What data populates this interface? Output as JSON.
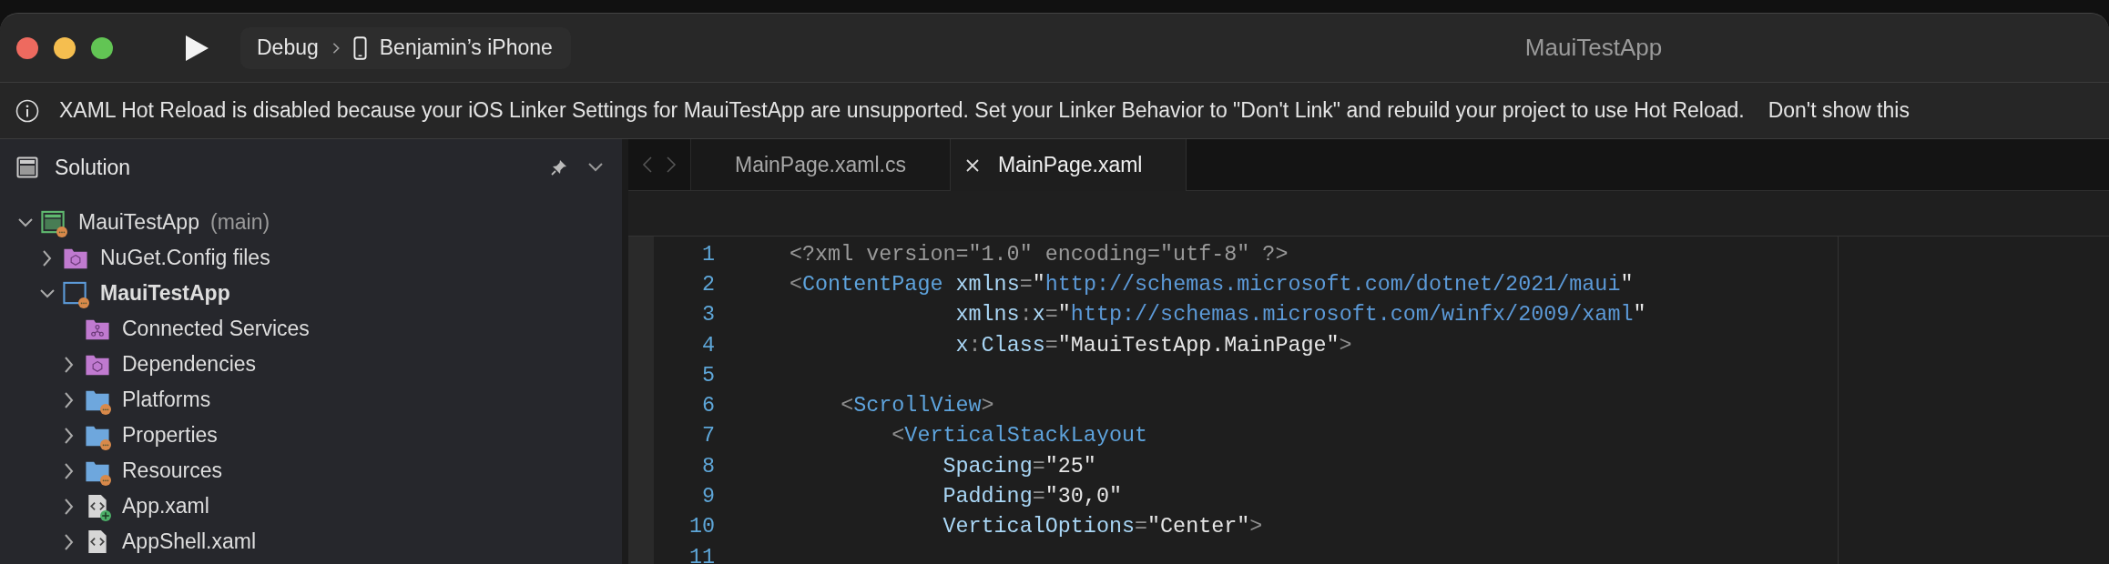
{
  "window": {
    "title": "MauiTestApp",
    "traffic_lights": [
      {
        "color": "#ee6a5f"
      },
      {
        "color": "#f5be4f"
      },
      {
        "color": "#62c554"
      }
    ]
  },
  "toolbar": {
    "configuration": "Debug",
    "device": "Benjamin’s iPhone"
  },
  "info_bar": {
    "message": "XAML Hot Reload is disabled because your iOS Linker Settings for MauiTestApp are unsupported. Set your Linker Behavior to \"Don't Link\" and rebuild your project to use Hot Reload.",
    "action": "Don't show this"
  },
  "sidebar": {
    "title": "Solution",
    "tree": [
      {
        "kind": "solution",
        "name": "MauiTestApp",
        "branch": "(main)",
        "modified": true,
        "expanded": true,
        "children": [
          {
            "kind": "package-folder",
            "name": "NuGet.Config files",
            "expanded": false
          },
          {
            "kind": "project",
            "name": "MauiTestApp",
            "modified": true,
            "expanded": true,
            "children": [
              {
                "kind": "service-folder",
                "name": "Connected Services"
              },
              {
                "kind": "package-folder",
                "name": "Dependencies",
                "expanded": false
              },
              {
                "kind": "folder",
                "name": "Platforms",
                "modified": true,
                "expanded": false
              },
              {
                "kind": "folder",
                "name": "Properties",
                "modified": true,
                "expanded": false
              },
              {
                "kind": "folder",
                "name": "Resources",
                "modified": true,
                "expanded": false
              },
              {
                "kind": "xaml-file",
                "name": "App.xaml",
                "added": true,
                "expanded": false
              },
              {
                "kind": "xaml-file",
                "name": "AppShell.xaml",
                "expanded": false
              }
            ]
          }
        ]
      }
    ]
  },
  "editor": {
    "tabs": [
      {
        "label": "MainPage.xaml.cs",
        "selected": false
      },
      {
        "label": "MainPage.xaml",
        "selected": true
      }
    ],
    "lines": [
      {
        "number": "1",
        "tokens": [
          {
            "kind": "decl",
            "text": "<?xml version=\"1.0\" encoding=\"utf-8\" ?>"
          }
        ]
      },
      {
        "number": "2",
        "tokens": [
          {
            "kind": "punct",
            "text": "<"
          },
          {
            "kind": "tag",
            "text": "ContentPage"
          },
          {
            "kind": "attr",
            "text": " xmlns"
          },
          {
            "kind": "punct",
            "text": "="
          },
          {
            "kind": "value",
            "text": "\""
          },
          {
            "kind": "url",
            "text": "http://schemas.microsoft.com/dotnet/2021/maui"
          },
          {
            "kind": "value",
            "text": "\""
          }
        ]
      },
      {
        "number": "3",
        "tokens": [
          {
            "kind": "attr",
            "text": "             xmlns"
          },
          {
            "kind": "punct",
            "text": ":"
          },
          {
            "kind": "attr",
            "text": "x"
          },
          {
            "kind": "punct",
            "text": "="
          },
          {
            "kind": "value",
            "text": "\""
          },
          {
            "kind": "url",
            "text": "http://schemas.microsoft.com/winfx/2009/xaml"
          },
          {
            "kind": "value",
            "text": "\""
          }
        ]
      },
      {
        "number": "4",
        "tokens": [
          {
            "kind": "attr",
            "text": "             x"
          },
          {
            "kind": "punct",
            "text": ":"
          },
          {
            "kind": "attr",
            "text": "Class"
          },
          {
            "kind": "punct",
            "text": "="
          },
          {
            "kind": "value",
            "text": "\"MauiTestApp.MainPage\""
          },
          {
            "kind": "punct",
            "text": ">"
          }
        ]
      },
      {
        "number": "5"
      },
      {
        "number": "6",
        "tokens": [
          {
            "kind": "punct",
            "text": "    <"
          },
          {
            "kind": "tag",
            "text": "ScrollView"
          },
          {
            "kind": "punct",
            "text": ">"
          }
        ]
      },
      {
        "number": "7",
        "tokens": [
          {
            "kind": "punct",
            "text": "        <"
          },
          {
            "kind": "tag",
            "text": "VerticalStackLayout"
          }
        ]
      },
      {
        "number": "8",
        "tokens": [
          {
            "kind": "attr",
            "text": "            Spacing"
          },
          {
            "kind": "punct",
            "text": "="
          },
          {
            "kind": "value",
            "text": "\"25\""
          }
        ]
      },
      {
        "number": "9",
        "tokens": [
          {
            "kind": "attr",
            "text": "            Padding"
          },
          {
            "kind": "punct",
            "text": "="
          },
          {
            "kind": "value",
            "text": "\"30,0\""
          }
        ]
      },
      {
        "number": "10",
        "tokens": [
          {
            "kind": "attr",
            "text": "            VerticalOptions"
          },
          {
            "kind": "punct",
            "text": "="
          },
          {
            "kind": "value",
            "text": "\"Center\""
          },
          {
            "kind": "punct",
            "text": ">"
          }
        ]
      },
      {
        "number": "11"
      }
    ]
  }
}
